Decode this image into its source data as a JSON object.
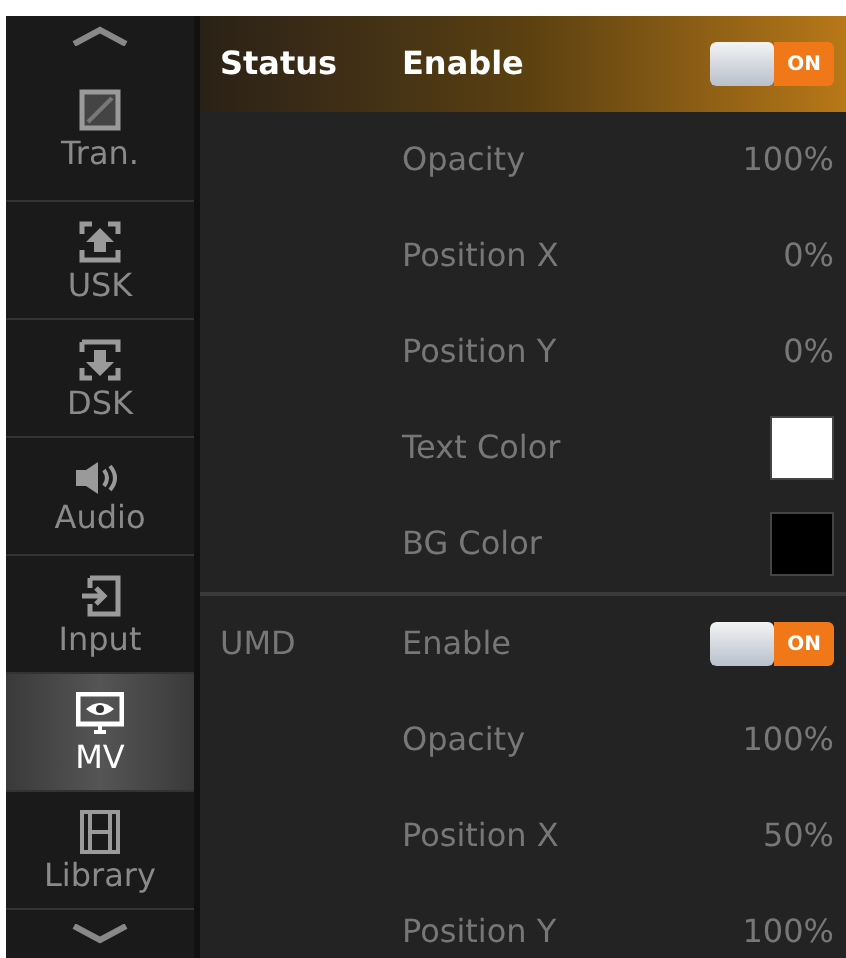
{
  "sidebar": {
    "items": [
      {
        "label": "Tran.",
        "selected": false
      },
      {
        "label": "USK",
        "selected": false
      },
      {
        "label": "DSK",
        "selected": false
      },
      {
        "label": "Audio",
        "selected": false
      },
      {
        "label": "Input",
        "selected": false
      },
      {
        "label": "MV",
        "selected": true
      },
      {
        "label": "Library",
        "selected": false
      }
    ]
  },
  "sections": [
    {
      "title": "Status",
      "selected": true,
      "rows": [
        {
          "kind": "toggle",
          "label": "Enable",
          "on": true,
          "state_text": "ON"
        },
        {
          "kind": "value",
          "label": "Opacity",
          "value": "100%"
        },
        {
          "kind": "value",
          "label": "Position X",
          "value": "0%"
        },
        {
          "kind": "value",
          "label": "Position Y",
          "value": "0%"
        },
        {
          "kind": "color",
          "label": "Text Color",
          "color": "#ffffff"
        },
        {
          "kind": "color",
          "label": "BG Color",
          "color": "#000000"
        }
      ]
    },
    {
      "title": "UMD",
      "selected": false,
      "rows": [
        {
          "kind": "toggle",
          "label": "Enable",
          "on": true,
          "state_text": "ON"
        },
        {
          "kind": "value",
          "label": "Opacity",
          "value": "100%"
        },
        {
          "kind": "value",
          "label": "Position X",
          "value": "50%"
        },
        {
          "kind": "value",
          "label": "Position Y",
          "value": "100%"
        }
      ]
    }
  ]
}
